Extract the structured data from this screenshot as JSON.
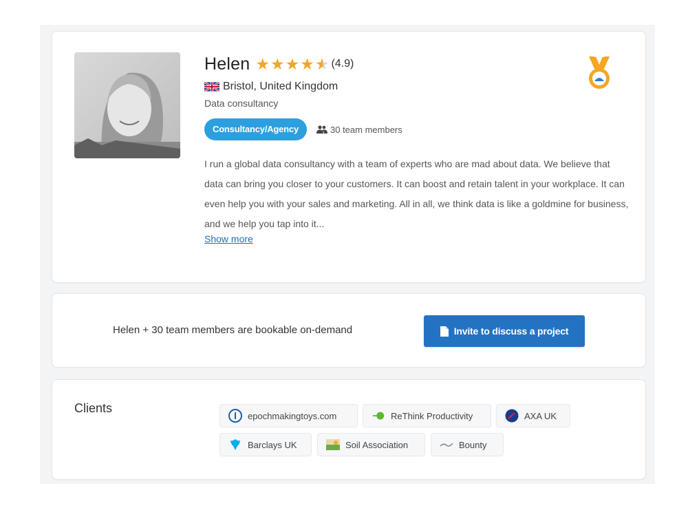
{
  "profile": {
    "name": "Helen",
    "rating": "(4.9)",
    "stars": 4.5,
    "location": "Bristol, United Kingdom",
    "tagline": "Data consultancy",
    "type_label": "Consultancy/Agency",
    "team_label": "30 team members",
    "bio": "I run a global data consultancy with a team of experts who are mad about data. We believe that data can bring you closer to your customers. It can boost and retain talent in your workplace. It can even help you with your sales and marketing. All in all, we think data is like a goldmine for business, and we help you tap into it...",
    "show_more": "Show more",
    "icons": {
      "flag": "uk-flag-icon",
      "team": "team-members-icon",
      "badge": "medal-badge-icon"
    }
  },
  "booking": {
    "text": "Helen + 30 team members are bookable on-demand",
    "button_label": "Invite to discuss a project",
    "button_icon": "document-icon",
    "button_color": "#2473c2"
  },
  "clients": {
    "title": "Clients",
    "items": [
      {
        "label": "epochmakingtoys.com",
        "icon": "epoch-logo"
      },
      {
        "label": "ReThink Productivity",
        "icon": "rethink-logo"
      },
      {
        "label": "AXA UK",
        "icon": "axa-logo"
      },
      {
        "label": "Barclays UK",
        "icon": "barclays-eagle-logo"
      },
      {
        "label": "Soil Association",
        "icon": "soil-association-logo"
      },
      {
        "label": "Bounty",
        "icon": "bounty-logo"
      }
    ]
  },
  "colors": {
    "accent": "#2c9fdf",
    "star": "#f5a623",
    "link": "#1e6fb8"
  }
}
